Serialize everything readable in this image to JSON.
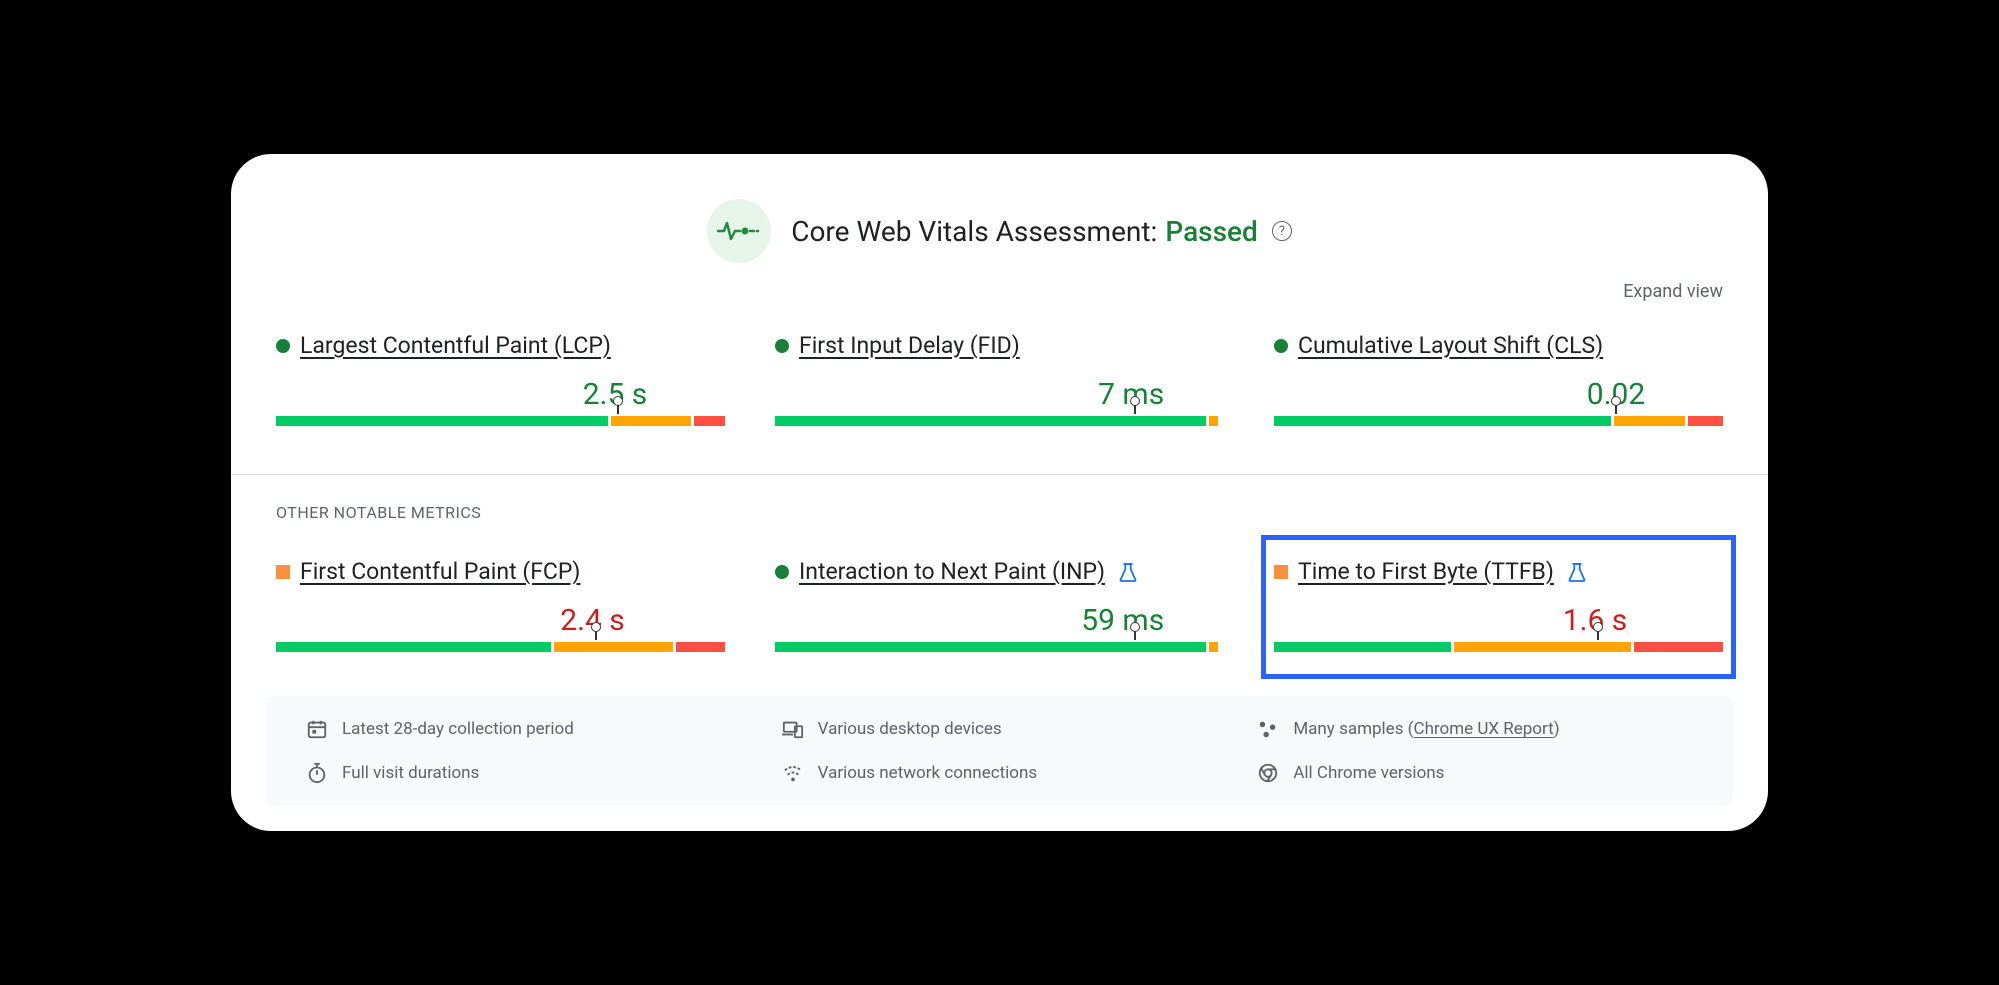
{
  "header": {
    "title_prefix": "Core Web Vitals Assessment:",
    "status": "Passed",
    "expand_link": "Expand view"
  },
  "section_label": "OTHER NOTABLE METRICS",
  "core_metrics": [
    {
      "name": "Largest Contentful Paint (LCP)",
      "value": "2.5 s",
      "status": "green",
      "segments": {
        "green": 75,
        "orange": 18,
        "red": 7
      },
      "marker_pct": 76
    },
    {
      "name": "First Input Delay (FID)",
      "value": "7 ms",
      "status": "green",
      "segments": {
        "green": 96,
        "orange": 2,
        "red": 0
      },
      "marker_pct": 80
    },
    {
      "name": "Cumulative Layout Shift (CLS)",
      "value": "0.02",
      "status": "green",
      "segments": {
        "green": 76,
        "orange": 16,
        "red": 8
      },
      "marker_pct": 76
    }
  ],
  "other_metrics": [
    {
      "name": "First Contentful Paint (FCP)",
      "value": "2.4 s",
      "status": "orange",
      "has_flask": false,
      "segments": {
        "green": 62,
        "orange": 27,
        "red": 11
      },
      "marker_pct": 71,
      "highlighted": false
    },
    {
      "name": "Interaction to Next Paint (INP)",
      "value": "59 ms",
      "status": "green",
      "has_flask": true,
      "segments": {
        "green": 96,
        "orange": 2,
        "red": 0
      },
      "marker_pct": 80,
      "highlighted": false
    },
    {
      "name": "Time to First Byte (TTFB)",
      "value": "1.6 s",
      "status": "orange",
      "has_flask": true,
      "segments": {
        "green": 40,
        "orange": 40,
        "red": 20
      },
      "marker_pct": 72,
      "highlighted": true
    }
  ],
  "footer": {
    "collection": "Latest 28-day collection period",
    "devices": "Various desktop devices",
    "samples_prefix": "Many samples (",
    "samples_link": "Chrome UX Report",
    "samples_suffix": ")",
    "durations": "Full visit durations",
    "network": "Various network connections",
    "chrome": "All Chrome versions"
  }
}
